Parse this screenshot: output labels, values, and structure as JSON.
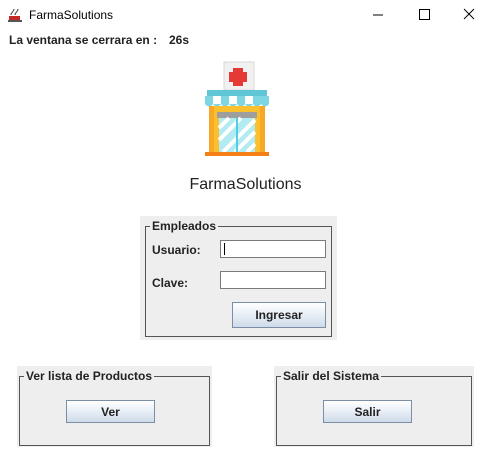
{
  "window": {
    "title": "FarmaSolutions",
    "icon": "coffee-cup-icon"
  },
  "countdown": {
    "label": "La ventana se cerrara en :",
    "value": "26s"
  },
  "logo": {
    "icon": "pharmacy-store-icon"
  },
  "app_name": "FarmaSolutions",
  "login": {
    "legend": "Empleados",
    "user_label": "Usuario:",
    "user_value": "",
    "password_label": "Clave:",
    "password_value": "",
    "submit_label": "Ingresar"
  },
  "products": {
    "legend": "Ver lista de Productos",
    "button_label": "Ver"
  },
  "exit": {
    "legend": "Salir del Sistema",
    "button_label": "Salir"
  },
  "colors": {
    "button_gradient_bottom": "#cfdbe9",
    "panel_bg": "#eeeeee",
    "logo_cross": "#e53935"
  }
}
